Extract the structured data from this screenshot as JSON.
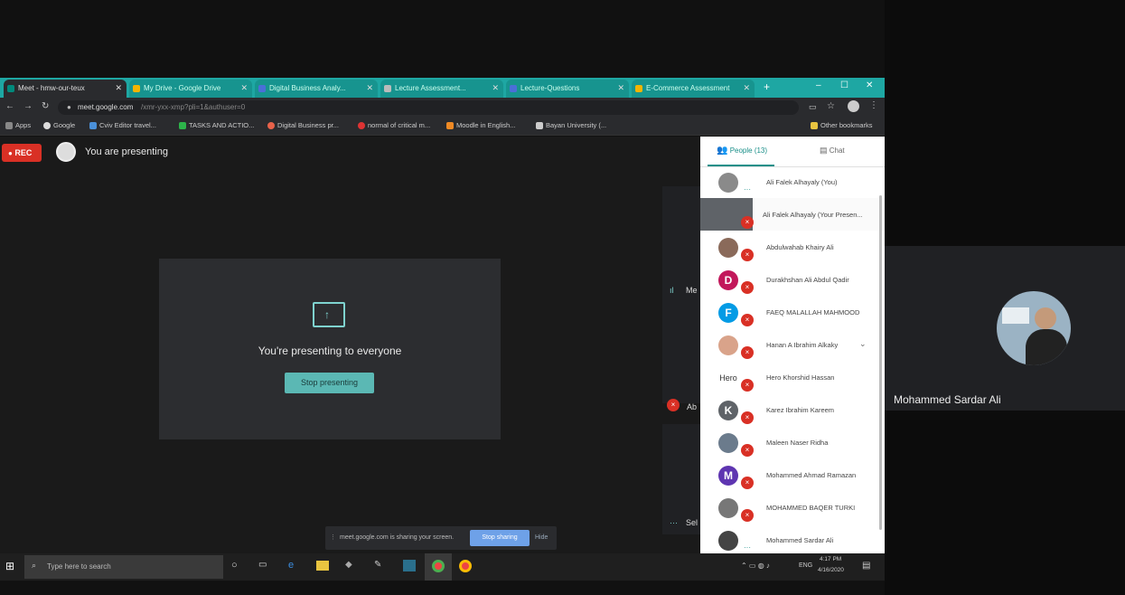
{
  "browser": {
    "tabs": [
      {
        "label": "Meet - hmw-our-teux"
      },
      {
        "label": "My Drive - Google Drive"
      },
      {
        "label": "Digital Business Analy..."
      },
      {
        "label": "Lecture Assessment..."
      },
      {
        "label": "Lecture-Questions"
      },
      {
        "label": "E-Commerce Assessment"
      }
    ],
    "address": "meet.google.com",
    "address_path": "/xmr-yxx-xmp?pli=1&authuser=0",
    "bookmarks": [
      "Apps",
      "Google",
      "Cviv Editor travel...",
      "TASKS AND ACTIO...",
      "Digital Business pr...",
      "normal of critical m...",
      "Moodle in English...",
      "Bayan University (...",
      "Other bookmarks"
    ]
  },
  "meet": {
    "rec_label": "REC",
    "presenting_label": "You are presenting",
    "presenting_message": "You're presenting to everyone",
    "stop_button": "Stop presenting",
    "share_notice": "meet.google.com is sharing your screen.",
    "stop_sharing": "Stop sharing",
    "hide": "Hide",
    "partial_labels": [
      "Me",
      "Ab",
      "Sel"
    ]
  },
  "panel": {
    "people_tab": "People (13)",
    "chat_tab": "Chat",
    "participants": [
      {
        "name": "Ali Falek Alhayaly (You)",
        "avatar": "",
        "color": "#8a8a8a"
      },
      {
        "name": "Ali Falek Alhayaly (Your Presen...",
        "avatar": "",
        "color": "#5f6368"
      },
      {
        "name": "Abdulwahab Khairy Ali",
        "avatar": "",
        "color": "#8a6a5a"
      },
      {
        "name": "Durakhshan Ali Abdul Qadir",
        "avatar": "D",
        "color": "#c2185b"
      },
      {
        "name": "FAEQ MALALLAH MAHMOOD",
        "avatar": "F",
        "color": "#039be5"
      },
      {
        "name": "Hanan A Ibrahim Alkaky",
        "avatar": "",
        "color": "#d9a38a"
      },
      {
        "name": "Hero Khorshid Hassan",
        "avatar": "Hero",
        "color": "#ffffff"
      },
      {
        "name": "Karez Ibrahim Kareem",
        "avatar": "K",
        "color": "#5f6368"
      },
      {
        "name": "Maleen Naser Ridha",
        "avatar": "",
        "color": "#6b7b8c"
      },
      {
        "name": "Mohammed Ahmad Ramazan",
        "avatar": "M",
        "color": "#5e35b1"
      },
      {
        "name": "MOHAMMED BAQER TURKI",
        "avatar": "",
        "color": "#777"
      },
      {
        "name": "Mohammed Sardar Ali",
        "avatar": "",
        "color": "#444"
      }
    ]
  },
  "right_tile": {
    "name": "Mohammed Sardar Ali"
  },
  "taskbar": {
    "search_placeholder": "Type here to search",
    "time": "4:17 PM",
    "date": "4/16/2020",
    "lang": "ENG"
  }
}
